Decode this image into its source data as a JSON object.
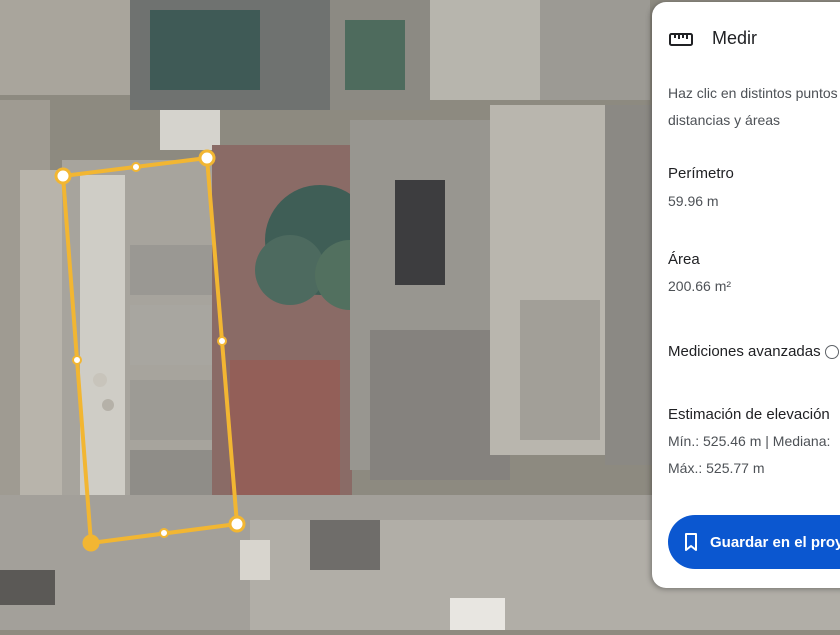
{
  "panel": {
    "title": "Medir",
    "description_line1": "Haz clic en distintos puntos",
    "description_line2": "distancias y áreas",
    "perimeter_label": "Perímetro",
    "perimeter_value": "59.96 m",
    "area_label": "Área",
    "area_value": "200.66 m²",
    "advanced_label": "Mediciones avanzadas",
    "elevation_label": "Estimación de elevación",
    "elevation_line1": "Mín.: 525.46 m | Mediana:",
    "elevation_line2": "Máx.: 525.77 m",
    "save_label": "Guardar en el proyecto"
  },
  "colors": {
    "measure_line": "#f2b632",
    "accent_button": "#0b57d0",
    "panel_bg": "#ffffff"
  },
  "icons": [
    "ruler-icon",
    "info-icon",
    "bookmark-icon"
  ]
}
